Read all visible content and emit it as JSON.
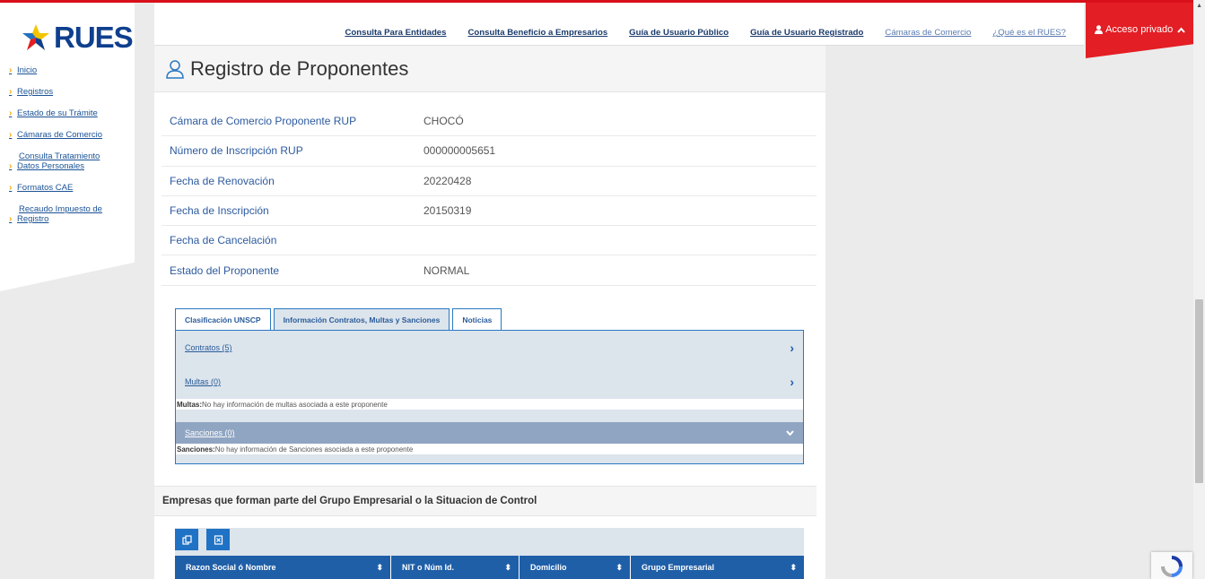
{
  "brand": {
    "name": "RUES",
    "primary_color": "#0f3f8e",
    "accent_color": "#e31e24"
  },
  "sidebar": {
    "items": [
      {
        "label": "Inicio"
      },
      {
        "label": "Registros"
      },
      {
        "label": "Estado de su Trámite"
      },
      {
        "label": "Cámaras de Comercio"
      },
      {
        "label_line1": "Consulta Tratamiento",
        "label_line2": "Datos Personales"
      },
      {
        "label": "Formatos CAE"
      },
      {
        "label_line1": "Recaudo Impuesto de",
        "label_line2": "Registro"
      }
    ]
  },
  "header": {
    "nav": [
      {
        "label": "Consulta Para Entidades"
      },
      {
        "label": "Consulta Beneficio a Empresarios"
      },
      {
        "label": "Guía de Usuario Público"
      },
      {
        "label": "Guía de Usuario Registrado"
      },
      {
        "label": "Cámaras de Comercio"
      },
      {
        "label": "¿Qué es el RUES?"
      }
    ],
    "private_access": "Acceso privado"
  },
  "page": {
    "title": "Registro de Proponentes"
  },
  "details": [
    {
      "label": "Cámara de Comercio Proponente RUP",
      "value": "CHOCÓ"
    },
    {
      "label": "Número de Inscripción RUP",
      "value": "000000005651"
    },
    {
      "label": "Fecha de Renovación",
      "value": "20220428"
    },
    {
      "label": "Fecha de Inscripción",
      "value": "20150319"
    },
    {
      "label": "Fecha de Cancelación",
      "value": ""
    },
    {
      "label": "Estado del Proponente",
      "value": "NORMAL"
    }
  ],
  "tabs": [
    {
      "label": "Clasificación UNSCP"
    },
    {
      "label": "Información Contratos, Multas y Sanciones"
    },
    {
      "label": "Noticias"
    }
  ],
  "accordion": {
    "contratos": "Contratos (5)",
    "multas": "Multas (0)",
    "multas_note_label": "Multas:",
    "multas_note": " No hay información de multas asociada a este proponente",
    "sanciones": "Sanciones (0)",
    "sanciones_note_label": "Sanciones:",
    "sanciones_note": " No hay información de Sanciones asociada a este proponente"
  },
  "group_section": {
    "title": "Empresas que forman parte del Grupo Empresarial o la Situacion de Control",
    "columns": [
      {
        "label": "Razon Social ó Nombre"
      },
      {
        "label": "NIT o Núm Id."
      },
      {
        "label": "Domicilio"
      },
      {
        "label": "Grupo Empresarial"
      }
    ]
  }
}
